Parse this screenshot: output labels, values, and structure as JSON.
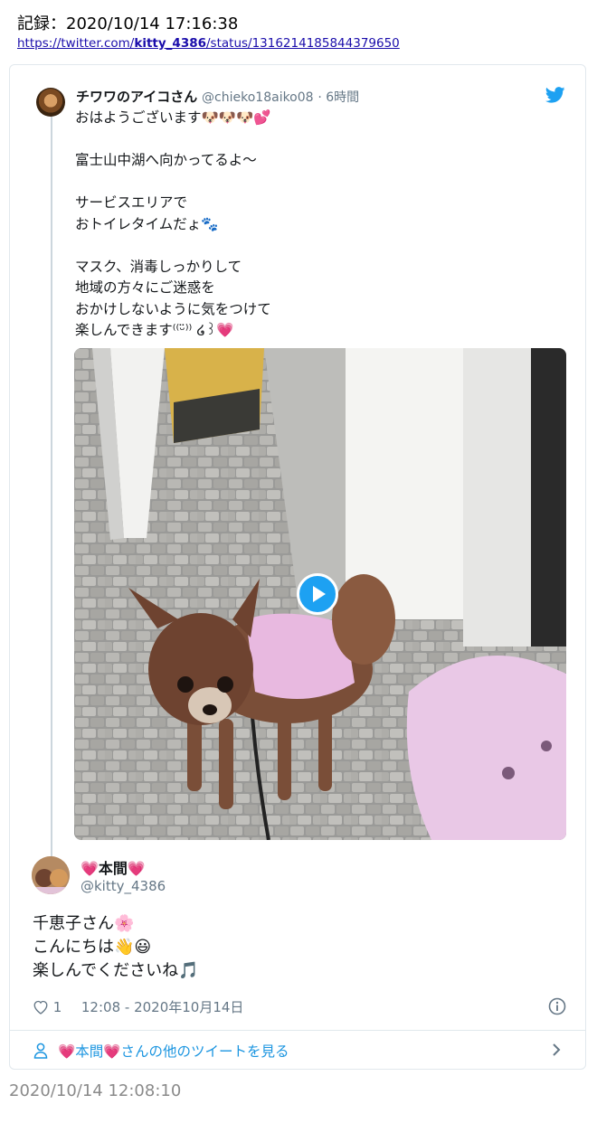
{
  "record": {
    "title": "記録：2020/10/14 17:16:38",
    "url_prefix": "https://twitter.com/",
    "url_user": "kitty_4386",
    "url_suffix": "/status/1316214185844379650"
  },
  "tweet": {
    "name": "チワワのアイコさん",
    "handle": "@chieko18aiko08",
    "time": "· 6時間",
    "lines": [
      "おはようございます🐶🐶🐶💕",
      "",
      "富士山中湖へ向かってるよ〜",
      "",
      "サービスエリアで",
      "おトイレタイムだょ🐾",
      "",
      "マスク、消毒しっかりして",
      "地域の方々にご迷惑を",
      "おかけしないように気をつけて",
      "楽しんできます⁽⁽ᵕ̈⁾⁾ ໒꒱💗"
    ]
  },
  "reply": {
    "name": "💗本間💗",
    "handle": "@kitty_4386",
    "lines": [
      "千恵子さん🌸",
      "こんにちは👋😃",
      "楽しんでくださいね🎵"
    ],
    "like_count": "1",
    "timestamp": "12:08 - 2020年10月14日"
  },
  "more_link": "💗本間💗さんの他のツイートを見る",
  "footer_time": "2020/10/14 12:08:10",
  "colors": {
    "accent": "#1da1f2",
    "link": "#1b95e0",
    "muted": "#657786"
  }
}
